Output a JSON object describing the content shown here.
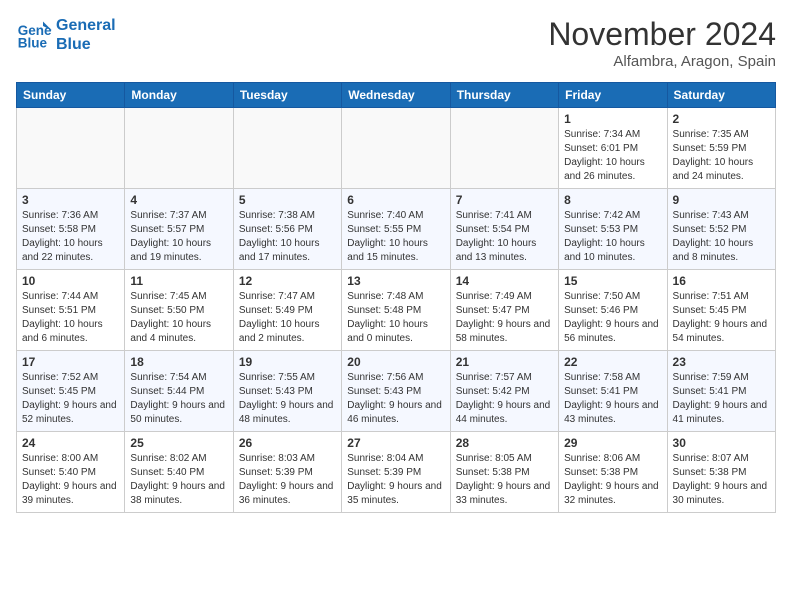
{
  "header": {
    "logo_line1": "General",
    "logo_line2": "Blue",
    "month": "November 2024",
    "location": "Alfambra, Aragon, Spain"
  },
  "weekdays": [
    "Sunday",
    "Monday",
    "Tuesday",
    "Wednesday",
    "Thursday",
    "Friday",
    "Saturday"
  ],
  "weeks": [
    [
      {
        "day": "",
        "info": ""
      },
      {
        "day": "",
        "info": ""
      },
      {
        "day": "",
        "info": ""
      },
      {
        "day": "",
        "info": ""
      },
      {
        "day": "",
        "info": ""
      },
      {
        "day": "1",
        "info": "Sunrise: 7:34 AM\nSunset: 6:01 PM\nDaylight: 10 hours and 26 minutes."
      },
      {
        "day": "2",
        "info": "Sunrise: 7:35 AM\nSunset: 5:59 PM\nDaylight: 10 hours and 24 minutes."
      }
    ],
    [
      {
        "day": "3",
        "info": "Sunrise: 7:36 AM\nSunset: 5:58 PM\nDaylight: 10 hours and 22 minutes."
      },
      {
        "day": "4",
        "info": "Sunrise: 7:37 AM\nSunset: 5:57 PM\nDaylight: 10 hours and 19 minutes."
      },
      {
        "day": "5",
        "info": "Sunrise: 7:38 AM\nSunset: 5:56 PM\nDaylight: 10 hours and 17 minutes."
      },
      {
        "day": "6",
        "info": "Sunrise: 7:40 AM\nSunset: 5:55 PM\nDaylight: 10 hours and 15 minutes."
      },
      {
        "day": "7",
        "info": "Sunrise: 7:41 AM\nSunset: 5:54 PM\nDaylight: 10 hours and 13 minutes."
      },
      {
        "day": "8",
        "info": "Sunrise: 7:42 AM\nSunset: 5:53 PM\nDaylight: 10 hours and 10 minutes."
      },
      {
        "day": "9",
        "info": "Sunrise: 7:43 AM\nSunset: 5:52 PM\nDaylight: 10 hours and 8 minutes."
      }
    ],
    [
      {
        "day": "10",
        "info": "Sunrise: 7:44 AM\nSunset: 5:51 PM\nDaylight: 10 hours and 6 minutes."
      },
      {
        "day": "11",
        "info": "Sunrise: 7:45 AM\nSunset: 5:50 PM\nDaylight: 10 hours and 4 minutes."
      },
      {
        "day": "12",
        "info": "Sunrise: 7:47 AM\nSunset: 5:49 PM\nDaylight: 10 hours and 2 minutes."
      },
      {
        "day": "13",
        "info": "Sunrise: 7:48 AM\nSunset: 5:48 PM\nDaylight: 10 hours and 0 minutes."
      },
      {
        "day": "14",
        "info": "Sunrise: 7:49 AM\nSunset: 5:47 PM\nDaylight: 9 hours and 58 minutes."
      },
      {
        "day": "15",
        "info": "Sunrise: 7:50 AM\nSunset: 5:46 PM\nDaylight: 9 hours and 56 minutes."
      },
      {
        "day": "16",
        "info": "Sunrise: 7:51 AM\nSunset: 5:45 PM\nDaylight: 9 hours and 54 minutes."
      }
    ],
    [
      {
        "day": "17",
        "info": "Sunrise: 7:52 AM\nSunset: 5:45 PM\nDaylight: 9 hours and 52 minutes."
      },
      {
        "day": "18",
        "info": "Sunrise: 7:54 AM\nSunset: 5:44 PM\nDaylight: 9 hours and 50 minutes."
      },
      {
        "day": "19",
        "info": "Sunrise: 7:55 AM\nSunset: 5:43 PM\nDaylight: 9 hours and 48 minutes."
      },
      {
        "day": "20",
        "info": "Sunrise: 7:56 AM\nSunset: 5:43 PM\nDaylight: 9 hours and 46 minutes."
      },
      {
        "day": "21",
        "info": "Sunrise: 7:57 AM\nSunset: 5:42 PM\nDaylight: 9 hours and 44 minutes."
      },
      {
        "day": "22",
        "info": "Sunrise: 7:58 AM\nSunset: 5:41 PM\nDaylight: 9 hours and 43 minutes."
      },
      {
        "day": "23",
        "info": "Sunrise: 7:59 AM\nSunset: 5:41 PM\nDaylight: 9 hours and 41 minutes."
      }
    ],
    [
      {
        "day": "24",
        "info": "Sunrise: 8:00 AM\nSunset: 5:40 PM\nDaylight: 9 hours and 39 minutes."
      },
      {
        "day": "25",
        "info": "Sunrise: 8:02 AM\nSunset: 5:40 PM\nDaylight: 9 hours and 38 minutes."
      },
      {
        "day": "26",
        "info": "Sunrise: 8:03 AM\nSunset: 5:39 PM\nDaylight: 9 hours and 36 minutes."
      },
      {
        "day": "27",
        "info": "Sunrise: 8:04 AM\nSunset: 5:39 PM\nDaylight: 9 hours and 35 minutes."
      },
      {
        "day": "28",
        "info": "Sunrise: 8:05 AM\nSunset: 5:38 PM\nDaylight: 9 hours and 33 minutes."
      },
      {
        "day": "29",
        "info": "Sunrise: 8:06 AM\nSunset: 5:38 PM\nDaylight: 9 hours and 32 minutes."
      },
      {
        "day": "30",
        "info": "Sunrise: 8:07 AM\nSunset: 5:38 PM\nDaylight: 9 hours and 30 minutes."
      }
    ]
  ]
}
